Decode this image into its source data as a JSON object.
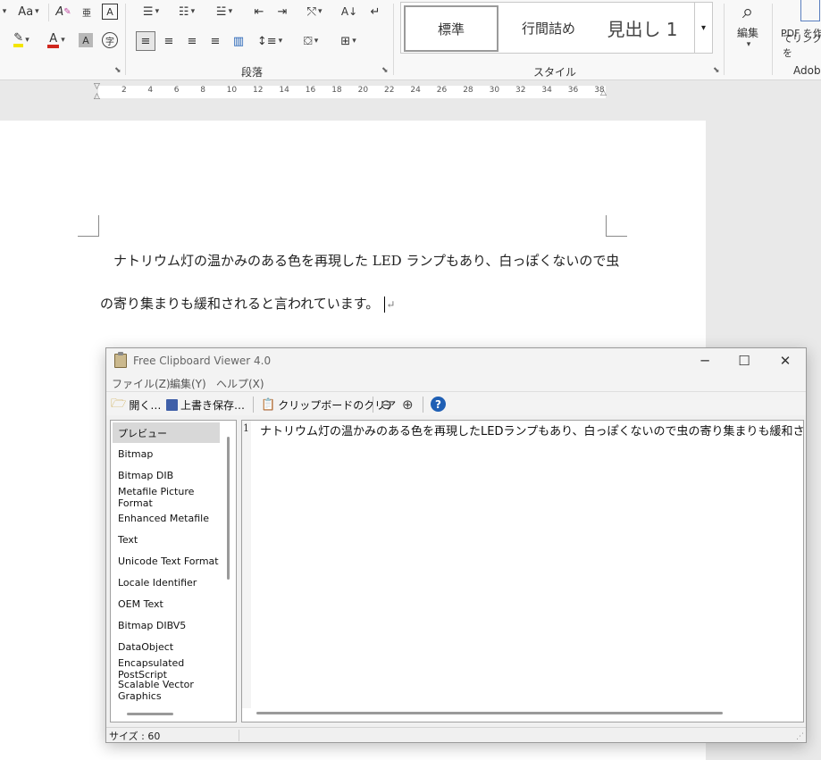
{
  "ribbon": {
    "font_size_label": "Aa",
    "paragraph_group": "段落",
    "style_group": "スタイル",
    "styles": [
      "標準",
      "行間詰め",
      "見出し 1"
    ],
    "edit_label": "編集",
    "pdf_label_1": "PDF を作",
    "pdf_label_2": "てリンクを",
    "adobe_label": "Adob"
  },
  "ruler": {
    "ticks": [
      "2",
      "4",
      "6",
      "8",
      "10",
      "12",
      "14",
      "16",
      "18",
      "20",
      "22",
      "24",
      "26",
      "28",
      "30",
      "32",
      "34",
      "36",
      "38"
    ]
  },
  "document": {
    "line1": "ナトリウム灯の温かみのある色を再現した LED ランプもあり、白っぽくないので虫",
    "line2": "の寄り集まりも緩和されると言われています。",
    "para_mark": "↵"
  },
  "viewer": {
    "title": "Free Clipboard Viewer 4.0",
    "menus": [
      "ファイル(Z)",
      "編集(Y)",
      "ヘルプ(X)"
    ],
    "toolbar": {
      "open": "開く…",
      "overwrite_save": "上書き保存…",
      "clear_clipboard": "クリップボードのクリア"
    },
    "formats": [
      "プレビュー",
      "Bitmap",
      "Bitmap DIB",
      "Metafile Picture Format",
      "Enhanced Metafile",
      "Text",
      "Unicode Text Format",
      "Locale Identifier",
      "OEM Text",
      "Bitmap DIBV5",
      "DataObject",
      "Encapsulated PostScript",
      "Scalable Vector Graphics"
    ],
    "selected_format_index": 0,
    "preview_line_number": "1",
    "preview_text": "ナトリウム灯の温かみのある色を再現したLEDランプもあり、白っぽくないので虫の寄り集まりも緩和されると言われています。",
    "status_size": "サイズ : 60"
  },
  "colors": {
    "highlight": "#f3e500",
    "font_color": "#d0281e",
    "help_blue": "#1f5fb4"
  }
}
